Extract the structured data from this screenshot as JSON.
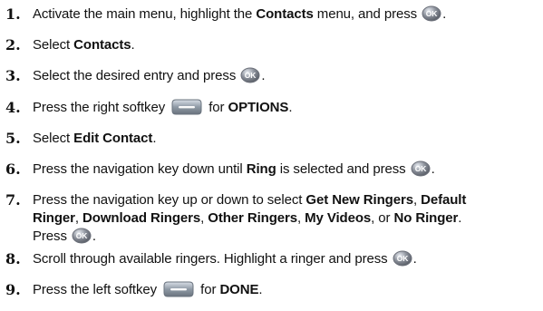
{
  "steps": [
    {
      "num": "1.",
      "parts": [
        {
          "t": "Activate the main menu, highlight the "
        },
        {
          "t": "Contacts",
          "b": true
        },
        {
          "t": " menu, and press "
        },
        {
          "icon": "ok"
        },
        {
          "t": "."
        }
      ]
    },
    {
      "num": "2.",
      "parts": [
        {
          "t": "Select "
        },
        {
          "t": "Contacts",
          "b": true
        },
        {
          "t": "."
        }
      ]
    },
    {
      "num": "3.",
      "parts": [
        {
          "t": "Select the desired entry and press "
        },
        {
          "icon": "ok"
        },
        {
          "t": "."
        }
      ]
    },
    {
      "num": "4.",
      "parts": [
        {
          "t": "Press the right softkey "
        },
        {
          "icon": "softkey"
        },
        {
          "t": " for "
        },
        {
          "t": "OPTIONS",
          "b": true
        },
        {
          "t": "."
        }
      ]
    },
    {
      "num": "5.",
      "parts": [
        {
          "t": "Select "
        },
        {
          "t": "Edit Contact",
          "b": true
        },
        {
          "t": "."
        }
      ]
    },
    {
      "num": "6.",
      "parts": [
        {
          "t": "Press the navigation key down until "
        },
        {
          "t": "Ring",
          "b": true
        },
        {
          "t": " is selected and press "
        },
        {
          "icon": "ok"
        },
        {
          "t": "."
        }
      ]
    },
    {
      "num": "7.",
      "parts": [
        {
          "t": "Press the navigation key up or down to select "
        },
        {
          "t": "Get New Ringers",
          "b": true
        },
        {
          "t": ", "
        },
        {
          "t": "Default",
          "b": true
        },
        {
          "br": true
        },
        {
          "t": "Ringer",
          "b": true
        },
        {
          "t": ", "
        },
        {
          "t": "Download Ringers",
          "b": true
        },
        {
          "t": ", "
        },
        {
          "t": "Other Ringers",
          "b": true
        },
        {
          "t": ", "
        },
        {
          "t": "My Videos",
          "b": true
        },
        {
          "t": ", or "
        },
        {
          "t": "No Ringer",
          "b": true
        },
        {
          "t": "."
        },
        {
          "br": true
        },
        {
          "t": "Press "
        },
        {
          "icon": "ok"
        },
        {
          "t": "."
        }
      ]
    },
    {
      "num": "8.",
      "parts": [
        {
          "t": "Scroll through available ringers. Highlight a ringer and press "
        },
        {
          "icon": "ok"
        },
        {
          "t": "."
        }
      ]
    },
    {
      "num": "9.",
      "parts": [
        {
          "t": "Press the left softkey "
        },
        {
          "icon": "softkey"
        },
        {
          "t": " for "
        },
        {
          "t": "DONE",
          "b": true
        },
        {
          "t": "."
        }
      ]
    }
  ],
  "icons": {
    "ok": {
      "name": "ok-button-icon",
      "label": "OK",
      "color": "#8a8f99"
    },
    "softkey": {
      "name": "softkey-icon",
      "color": "#8f9aa6"
    }
  }
}
